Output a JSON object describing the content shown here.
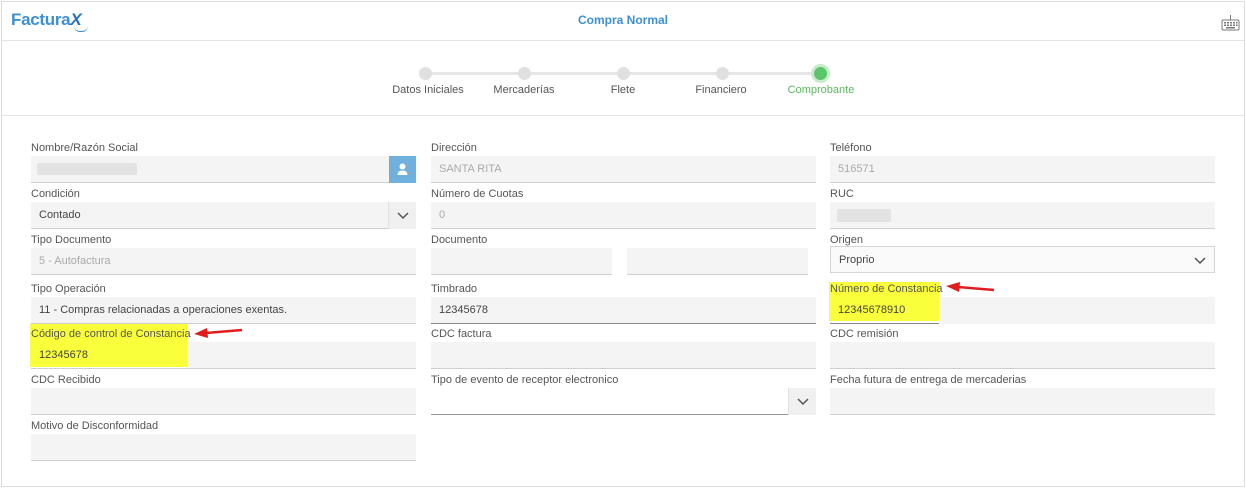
{
  "app": {
    "logo_text": "Factura",
    "logo_x": "X",
    "title": "Compra Normal"
  },
  "stepper": {
    "steps": [
      {
        "label": "Datos Iniciales",
        "active": false
      },
      {
        "label": "Mercaderías",
        "active": false
      },
      {
        "label": "Flete",
        "active": false
      },
      {
        "label": "Financiero",
        "active": false
      },
      {
        "label": "Comprobante",
        "active": true
      }
    ]
  },
  "form": {
    "nombre": {
      "label": "Nombre/Razón Social"
    },
    "direccion": {
      "label": "Dirección",
      "value": "SANTA RITA"
    },
    "telefono": {
      "label": "Teléfono",
      "value": "516571"
    },
    "condicion": {
      "label": "Condición",
      "value": "Contado"
    },
    "cuotas": {
      "label": "Número de Cuotas",
      "value": "0"
    },
    "ruc": {
      "label": "RUC"
    },
    "tipo_documento": {
      "label": "Tipo Documento",
      "value": "5 - Autofactura"
    },
    "documento": {
      "label": "Documento"
    },
    "origen": {
      "label": "Origen",
      "value": "Proprio"
    },
    "tipo_operacion": {
      "label": "Tipo Operación",
      "value": "11 - Compras relacionadas a operaciones exentas."
    },
    "timbrado": {
      "label": "Timbrado",
      "value": "12345678"
    },
    "numero_constancia": {
      "label": "Número de Constancia",
      "value": "12345678910"
    },
    "codigo_control": {
      "label": "Código de control de Constancia",
      "value": "12345678"
    },
    "cdc_factura": {
      "label": "CDC factura"
    },
    "cdc_remision": {
      "label": "CDC remisión"
    },
    "cdc_recibido": {
      "label": "CDC Recibido"
    },
    "tipo_evento": {
      "label": "Tipo de evento de receptor electronico"
    },
    "fecha_futura": {
      "label": "Fecha futura de entrega de mercaderias"
    },
    "motivo": {
      "label": "Motivo de Disconformidad"
    }
  },
  "colors": {
    "accent": "#3d8fd1",
    "active_step": "#5cb85c",
    "highlight": "#faff3c",
    "arrow": "#e21d1d"
  }
}
